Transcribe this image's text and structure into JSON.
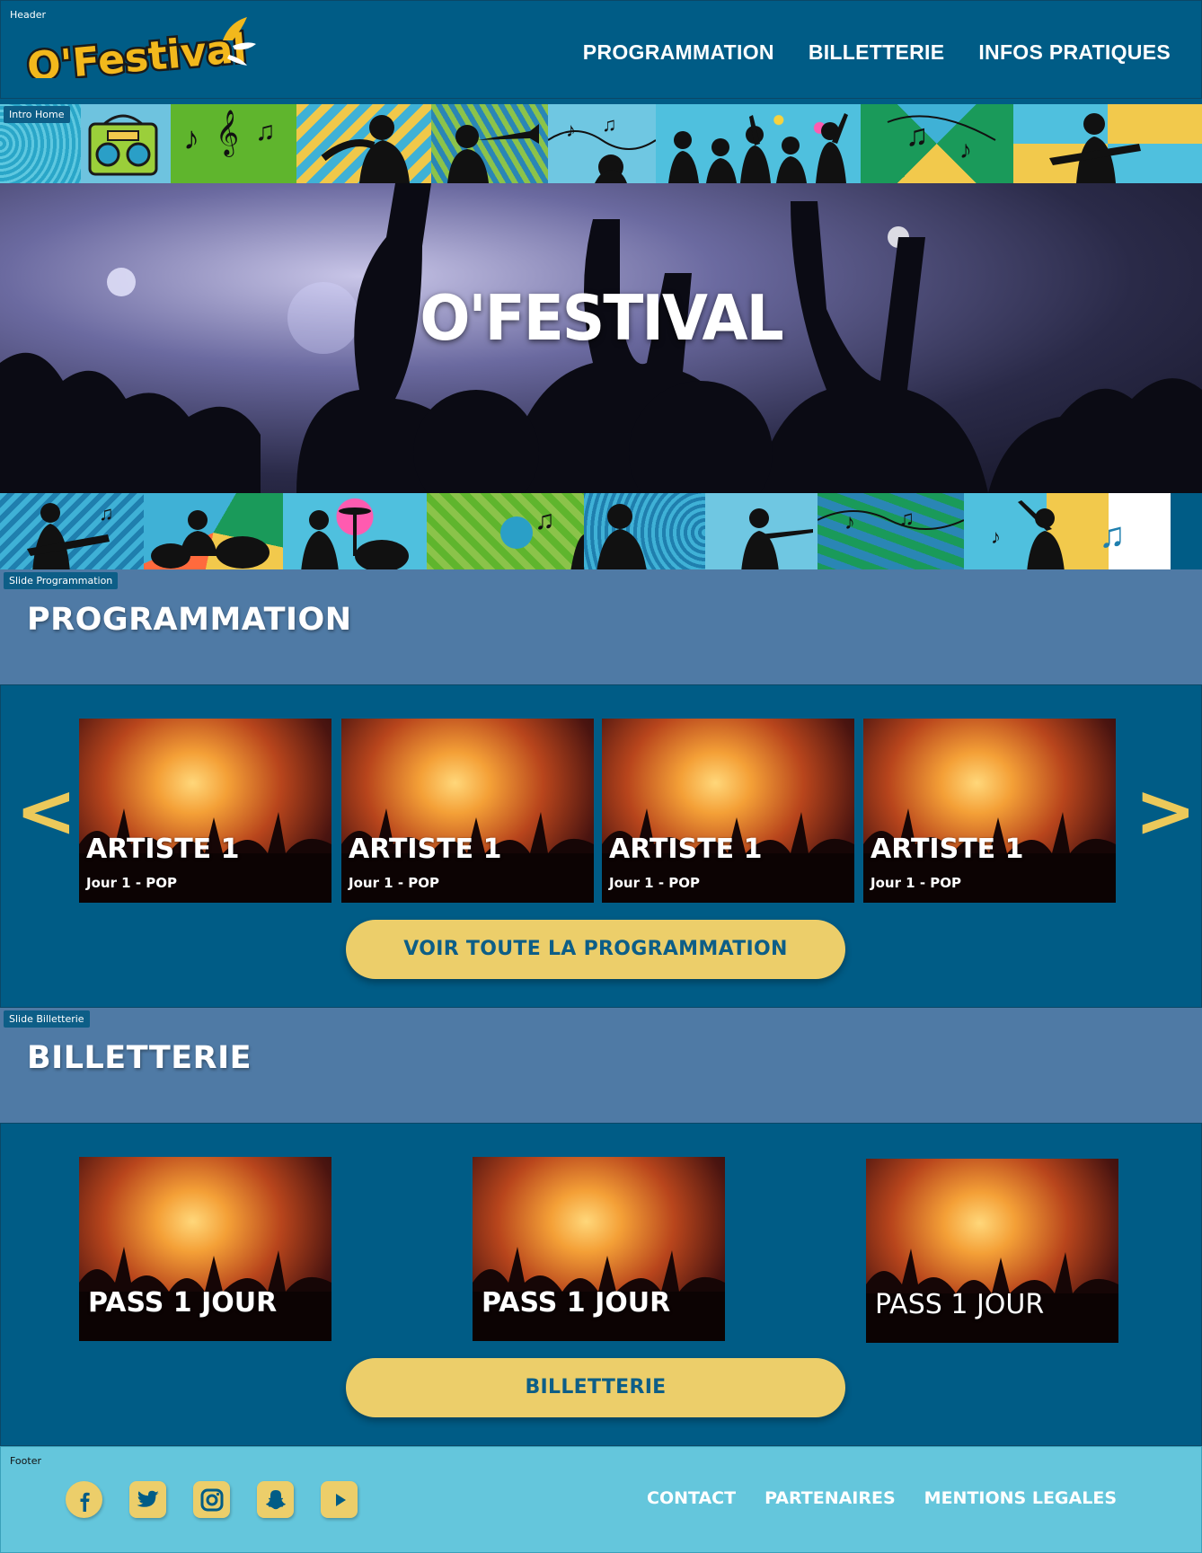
{
  "frame_tags": {
    "header": "Header",
    "intro": "Intro Home",
    "programmation": "Slide Programmation",
    "billetterie": "Slide Billetterie",
    "footer": "Footer"
  },
  "header": {
    "logo_text": "O'Festival",
    "nav": [
      "PROGRAMMATION",
      "BILLETTERIE",
      "INFOS PRATIQUES"
    ]
  },
  "intro": {
    "hero_title": "O'FESTIVAL"
  },
  "programmation": {
    "title": "PROGRAMMATION",
    "prev_arrow": "<",
    "next_arrow": ">",
    "cards": [
      {
        "title": "ARTISTE 1",
        "subtitle": "Jour 1 - POP"
      },
      {
        "title": "ARTISTE 1",
        "subtitle": "Jour 1 - POP"
      },
      {
        "title": "ARTISTE 1",
        "subtitle": "Jour 1 - POP"
      },
      {
        "title": "ARTISTE 1",
        "subtitle": "Jour 1 - POP"
      }
    ],
    "cta": "VOIR TOUTE LA PROGRAMMATION"
  },
  "billetterie": {
    "title": "BILLETTERIE",
    "passes": [
      "PASS 1 JOUR",
      "PASS 1 JOUR",
      "PASS 1 JOUR"
    ],
    "cta": "BILLETTERIE"
  },
  "footer": {
    "socials": [
      "facebook-icon",
      "twitter-icon",
      "instagram-icon",
      "snapchat-icon",
      "youtube-icon"
    ],
    "links": [
      "CONTACT",
      "PARTENAIRES",
      "MENTIONS LEGALES"
    ]
  },
  "colors": {
    "primary_blue": "#005c86",
    "section_blue": "#4f7aa5",
    "accent_yellow": "#ecce6a",
    "footer_cyan": "#64c6dc"
  }
}
